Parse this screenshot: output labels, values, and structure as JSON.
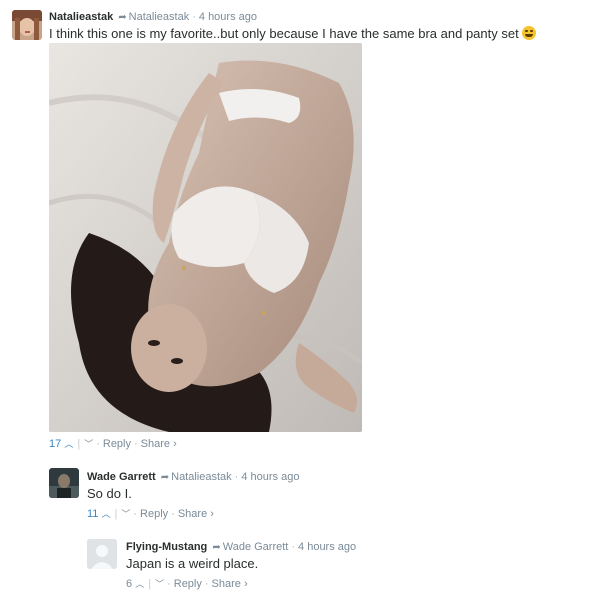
{
  "comments": [
    {
      "author": "Natalieastak",
      "reply_to": "Natalieastak",
      "time": "4 hours ago",
      "text": "I think this one is my favorite..but only because I have the same bra and panty set",
      "upvotes": "17",
      "reply_label": "Reply",
      "share_label": "Share",
      "has_emoji": true,
      "emoji": "laughing-face-icon"
    },
    {
      "author": "Wade Garrett",
      "reply_to": "Natalieastak",
      "time": "4 hours ago",
      "text": "So do I.",
      "upvotes": "11",
      "reply_label": "Reply",
      "share_label": "Share"
    },
    {
      "author": "Flying-Mustang",
      "reply_to": "Wade Garrett",
      "time": "4 hours ago",
      "text": "Japan is a weird place.",
      "upvotes": "6",
      "reply_label": "Reply",
      "share_label": "Share"
    }
  ],
  "icons": {
    "reply_arrow": "reply-arrow-icon",
    "upvote": "upvote-chevron-icon",
    "downvote": "downvote-chevron-icon",
    "share_chevron": "share-chevron-icon"
  },
  "colors": {
    "author": "#2a2e2e",
    "meta": "#7b8b98",
    "upvote": "#3b87c5"
  }
}
